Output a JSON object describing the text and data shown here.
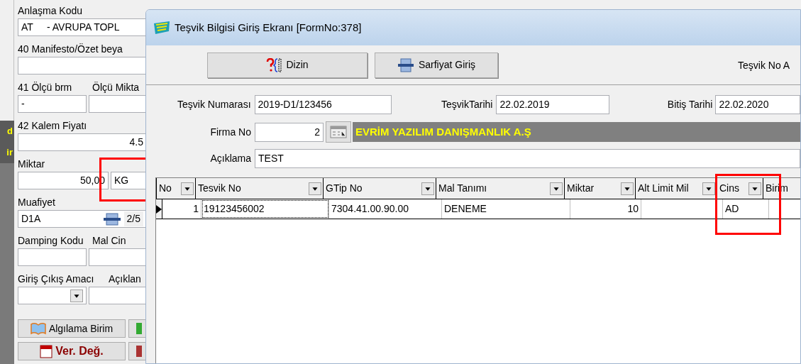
{
  "side_strip": {
    "texts": [
      "d",
      "ir"
    ]
  },
  "background_form": {
    "rows": [
      {
        "labels": [
          "Anlaşma Kodu"
        ],
        "fields": [
          {
            "value": "AT     - AVRUPA TOPL",
            "kind": "text"
          }
        ]
      },
      {
        "labels": [
          "40 Manifesto/Özet beya"
        ],
        "fields": [
          {
            "kind": "text"
          }
        ]
      },
      {
        "labels": [
          "41 Ölçü brm",
          "Ölçü Mikta"
        ],
        "fields": [
          {
            "value": "-",
            "kind": "text"
          },
          {
            "kind": "text"
          }
        ]
      },
      {
        "labels": [
          "42 Kalem Fiyatı"
        ],
        "fields": [
          {
            "value": "4.5",
            "kind": "number"
          }
        ]
      },
      {
        "labels": [
          "Miktar"
        ],
        "fields": [
          {
            "value": "50,00",
            "kind": "number"
          },
          {
            "value": "KG",
            "kind": "text",
            "highlighted": true
          }
        ]
      },
      {
        "labels": [
          "Muafiyet"
        ],
        "fields": [
          {
            "value": "D1A",
            "kind": "lookup",
            "count": "2/5"
          }
        ]
      },
      {
        "labels": [
          "Damping Kodu",
          "Mal Cin"
        ],
        "fields": [
          {
            "kind": "text"
          },
          {
            "kind": "text"
          }
        ]
      },
      {
        "labels": [
          "Giriş Çıkış Amacı",
          "Açıklan"
        ],
        "fields": [
          {
            "kind": "dropdown"
          },
          {
            "kind": "text"
          }
        ]
      }
    ],
    "buttons": [
      {
        "label": "Algılama Birim",
        "kind": "normal"
      },
      {
        "label": "Ver. Değ.",
        "kind": "bold"
      }
    ]
  },
  "dialog": {
    "title": "Teşvik Bilgisi Giriş Ekranı [FormNo:378]",
    "toolbar": [
      {
        "label": "Dizin",
        "kind": "index"
      },
      {
        "label": "Sarfiyat Giriş",
        "kind": "consume"
      }
    ],
    "teşvik_no_label": "Teşvik No A",
    "form": {
      "tesvik_numarasi": {
        "label": "Teşvik Numarası",
        "value": "2019-D1/123456"
      },
      "tesvik_tarihi": {
        "label": "TeşvikTarihi",
        "value": "22.02.2019"
      },
      "bitis_tarihi": {
        "label": "Bitiş Tarihi",
        "value": "22.02.2020"
      },
      "firma_no": {
        "label": "Firma No",
        "value": "2"
      },
      "company_name": "EVRİM YAZILIM DANIŞMANLIK A.Ş",
      "aciklama": {
        "label": "Açıklama",
        "value": "TEST"
      }
    },
    "grid": {
      "columns": [
        {
          "label": "No",
          "highlighted": false
        },
        {
          "label": "Tesvik No",
          "highlighted": false
        },
        {
          "label": "GTip No",
          "highlighted": false
        },
        {
          "label": "Mal Tanımı",
          "highlighted": false
        },
        {
          "label": "Miktar",
          "highlighted": false
        },
        {
          "label": "Alt Limit Mil",
          "highlighted": false
        },
        {
          "label": "Cins",
          "highlighted": true
        },
        {
          "label": "Birim",
          "highlighted": false
        }
      ],
      "rows": [
        {
          "selected": true,
          "cells": [
            "1",
            "19123456002",
            "7304.41.00.90.00",
            "DENEME",
            "10",
            null,
            "AD",
            null
          ]
        }
      ]
    }
  }
}
